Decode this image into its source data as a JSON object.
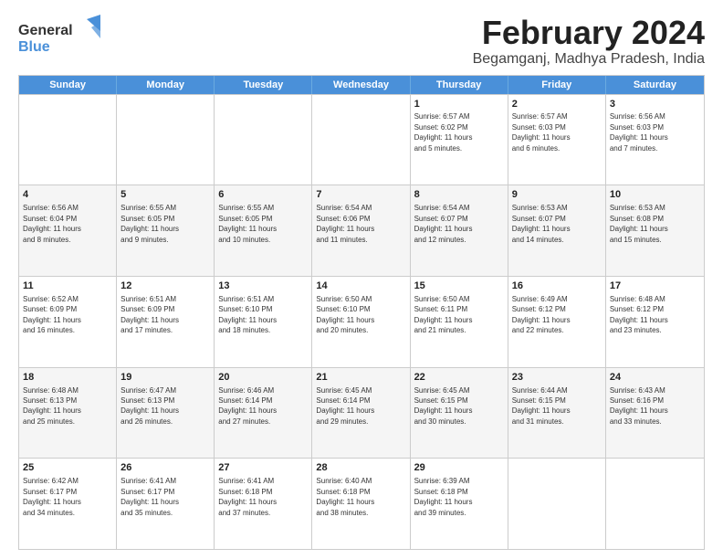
{
  "logo": {
    "part1": "General",
    "part2": "Blue"
  },
  "title": "February 2024",
  "subtitle": "Begamganj, Madhya Pradesh, India",
  "weekdays": [
    "Sunday",
    "Monday",
    "Tuesday",
    "Wednesday",
    "Thursday",
    "Friday",
    "Saturday"
  ],
  "weeks": [
    [
      {
        "day": "",
        "info": ""
      },
      {
        "day": "",
        "info": ""
      },
      {
        "day": "",
        "info": ""
      },
      {
        "day": "",
        "info": ""
      },
      {
        "day": "1",
        "info": "Sunrise: 6:57 AM\nSunset: 6:02 PM\nDaylight: 11 hours\nand 5 minutes."
      },
      {
        "day": "2",
        "info": "Sunrise: 6:57 AM\nSunset: 6:03 PM\nDaylight: 11 hours\nand 6 minutes."
      },
      {
        "day": "3",
        "info": "Sunrise: 6:56 AM\nSunset: 6:03 PM\nDaylight: 11 hours\nand 7 minutes."
      }
    ],
    [
      {
        "day": "4",
        "info": "Sunrise: 6:56 AM\nSunset: 6:04 PM\nDaylight: 11 hours\nand 8 minutes."
      },
      {
        "day": "5",
        "info": "Sunrise: 6:55 AM\nSunset: 6:05 PM\nDaylight: 11 hours\nand 9 minutes."
      },
      {
        "day": "6",
        "info": "Sunrise: 6:55 AM\nSunset: 6:05 PM\nDaylight: 11 hours\nand 10 minutes."
      },
      {
        "day": "7",
        "info": "Sunrise: 6:54 AM\nSunset: 6:06 PM\nDaylight: 11 hours\nand 11 minutes."
      },
      {
        "day": "8",
        "info": "Sunrise: 6:54 AM\nSunset: 6:07 PM\nDaylight: 11 hours\nand 12 minutes."
      },
      {
        "day": "9",
        "info": "Sunrise: 6:53 AM\nSunset: 6:07 PM\nDaylight: 11 hours\nand 14 minutes."
      },
      {
        "day": "10",
        "info": "Sunrise: 6:53 AM\nSunset: 6:08 PM\nDaylight: 11 hours\nand 15 minutes."
      }
    ],
    [
      {
        "day": "11",
        "info": "Sunrise: 6:52 AM\nSunset: 6:09 PM\nDaylight: 11 hours\nand 16 minutes."
      },
      {
        "day": "12",
        "info": "Sunrise: 6:51 AM\nSunset: 6:09 PM\nDaylight: 11 hours\nand 17 minutes."
      },
      {
        "day": "13",
        "info": "Sunrise: 6:51 AM\nSunset: 6:10 PM\nDaylight: 11 hours\nand 18 minutes."
      },
      {
        "day": "14",
        "info": "Sunrise: 6:50 AM\nSunset: 6:10 PM\nDaylight: 11 hours\nand 20 minutes."
      },
      {
        "day": "15",
        "info": "Sunrise: 6:50 AM\nSunset: 6:11 PM\nDaylight: 11 hours\nand 21 minutes."
      },
      {
        "day": "16",
        "info": "Sunrise: 6:49 AM\nSunset: 6:12 PM\nDaylight: 11 hours\nand 22 minutes."
      },
      {
        "day": "17",
        "info": "Sunrise: 6:48 AM\nSunset: 6:12 PM\nDaylight: 11 hours\nand 23 minutes."
      }
    ],
    [
      {
        "day": "18",
        "info": "Sunrise: 6:48 AM\nSunset: 6:13 PM\nDaylight: 11 hours\nand 25 minutes."
      },
      {
        "day": "19",
        "info": "Sunrise: 6:47 AM\nSunset: 6:13 PM\nDaylight: 11 hours\nand 26 minutes."
      },
      {
        "day": "20",
        "info": "Sunrise: 6:46 AM\nSunset: 6:14 PM\nDaylight: 11 hours\nand 27 minutes."
      },
      {
        "day": "21",
        "info": "Sunrise: 6:45 AM\nSunset: 6:14 PM\nDaylight: 11 hours\nand 29 minutes."
      },
      {
        "day": "22",
        "info": "Sunrise: 6:45 AM\nSunset: 6:15 PM\nDaylight: 11 hours\nand 30 minutes."
      },
      {
        "day": "23",
        "info": "Sunrise: 6:44 AM\nSunset: 6:15 PM\nDaylight: 11 hours\nand 31 minutes."
      },
      {
        "day": "24",
        "info": "Sunrise: 6:43 AM\nSunset: 6:16 PM\nDaylight: 11 hours\nand 33 minutes."
      }
    ],
    [
      {
        "day": "25",
        "info": "Sunrise: 6:42 AM\nSunset: 6:17 PM\nDaylight: 11 hours\nand 34 minutes."
      },
      {
        "day": "26",
        "info": "Sunrise: 6:41 AM\nSunset: 6:17 PM\nDaylight: 11 hours\nand 35 minutes."
      },
      {
        "day": "27",
        "info": "Sunrise: 6:41 AM\nSunset: 6:18 PM\nDaylight: 11 hours\nand 37 minutes."
      },
      {
        "day": "28",
        "info": "Sunrise: 6:40 AM\nSunset: 6:18 PM\nDaylight: 11 hours\nand 38 minutes."
      },
      {
        "day": "29",
        "info": "Sunrise: 6:39 AM\nSunset: 6:18 PM\nDaylight: 11 hours\nand 39 minutes."
      },
      {
        "day": "",
        "info": ""
      },
      {
        "day": "",
        "info": ""
      }
    ]
  ]
}
